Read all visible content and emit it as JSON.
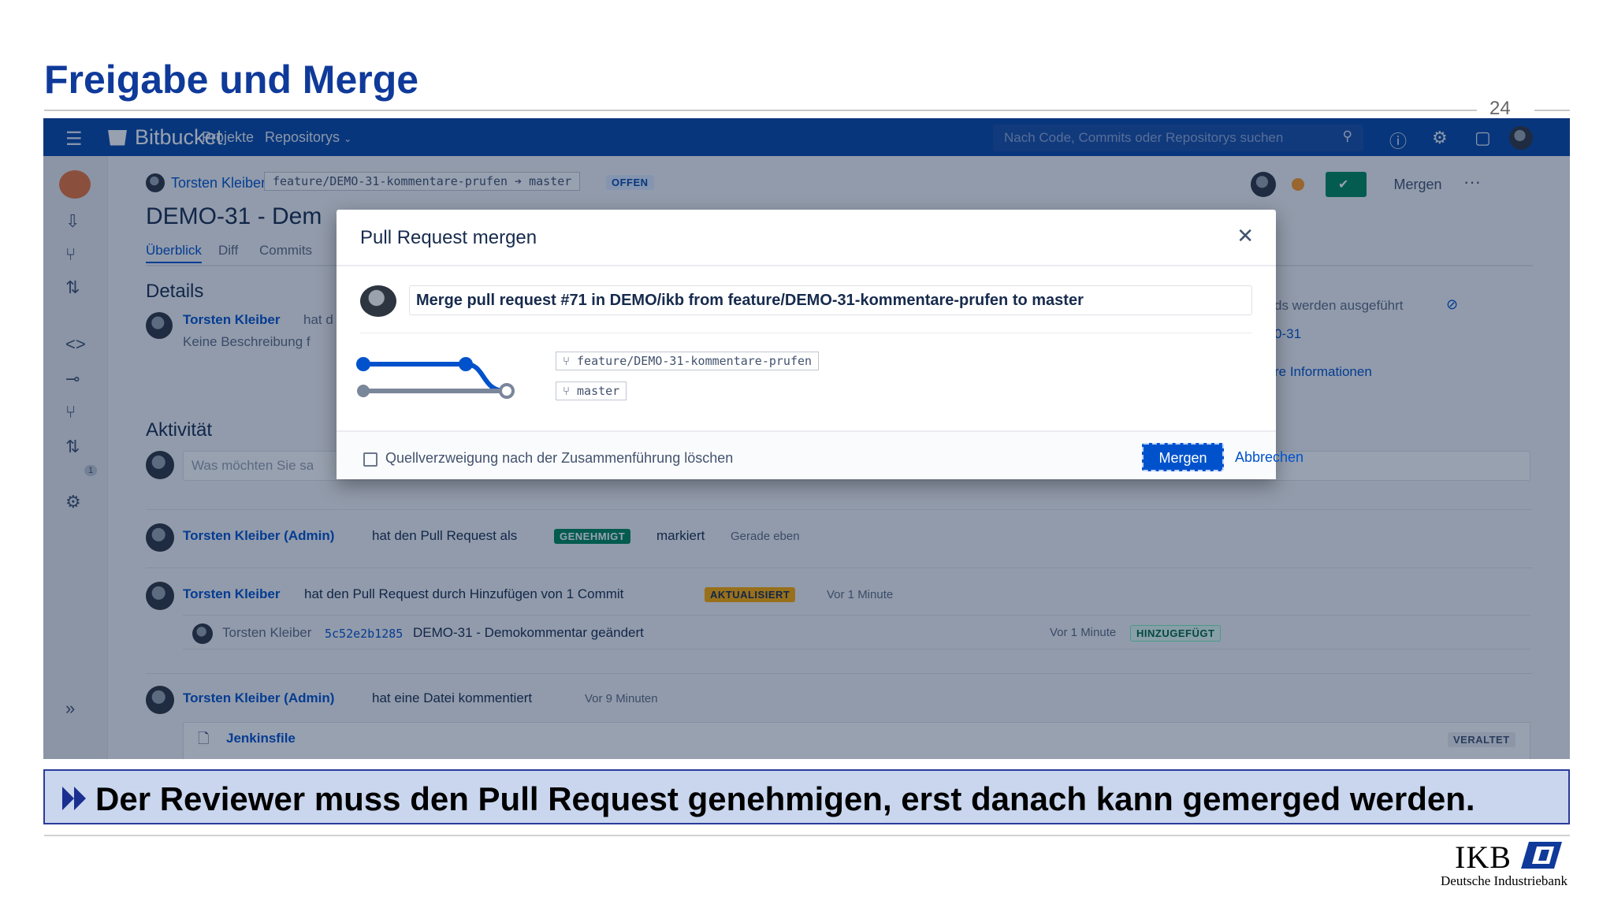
{
  "slide": {
    "title": "Freigabe und Merge",
    "page_number": "24",
    "callout": "Der Reviewer muss den Pull Request genehmigen, erst danach kann gemerged werden.",
    "logo_text": "IKB",
    "logo_subtext": "Deutsche Industriebank"
  },
  "topbar": {
    "brand": "Bitbucket",
    "nav": [
      "Projekte",
      "Repositorys"
    ],
    "search_placeholder": "Nach Code, Commits oder Repositorys suchen"
  },
  "pr_header": {
    "author": "Torsten Kleiber",
    "source_branch": "feature/DEMO-31-kommentare-prufen",
    "target_branch": "master",
    "status": "OFFEN",
    "merge_button": "Mergen",
    "more": "···"
  },
  "pr": {
    "title": "DEMO-31 - Dem",
    "tabs": [
      "Überblick",
      "Diff",
      "Commits"
    ],
    "details_heading": "Details",
    "details_author": "Torsten Kleiber",
    "details_author_suffix": "hat d",
    "details_desc": "Keine Beschreibung f",
    "right_col": [
      "ds werden ausgeführt",
      "0-31",
      "re Informationen"
    ],
    "activity_heading": "Aktivität",
    "comment_placeholder": "Was möchten Sie sa"
  },
  "activity": [
    {
      "user": "Torsten Kleiber (Admin)",
      "text1": "hat den Pull Request als",
      "badge": "GENEHMIGT",
      "text2": "markiert",
      "time": "Gerade eben"
    },
    {
      "user": "Torsten Kleiber",
      "text1": "hat den Pull Request durch Hinzufügen von 1 Commit",
      "badge": "AKTUALISIERT",
      "time": "Vor 1 Minute"
    },
    {
      "user": "Torsten Kleiber (Admin)",
      "text1": "hat eine Datei kommentiert",
      "time": "Vor 9 Minuten"
    }
  ],
  "commit_row": {
    "author": "Torsten Kleiber",
    "hash": "5c52e2b1285",
    "message": "DEMO-31 - Demokommentar geändert",
    "time": "Vor 1 Minute",
    "badge": "HINZUGEFÜGT"
  },
  "file_row": {
    "file": "Jenkinsfile",
    "badge": "VERALTET"
  },
  "sidebar_badge": "1",
  "modal": {
    "title": "Pull Request mergen",
    "commit_message": "Merge pull request #71 in DEMO/ikb from feature/DEMO-31-kommentare-prufen to master",
    "source_branch": "feature/DEMO-31-kommentare-prufen",
    "target_branch": "master",
    "checkbox_label": "Quellverzweigung nach der Zusammenführung löschen",
    "primary_button": "Mergen",
    "cancel_button": "Abbrechen"
  },
  "colors": {
    "brand": "#0747a6",
    "primary": "#0052cc",
    "title": "#0f3a9a",
    "approved": "#00875a",
    "updated": "#ffab00"
  }
}
